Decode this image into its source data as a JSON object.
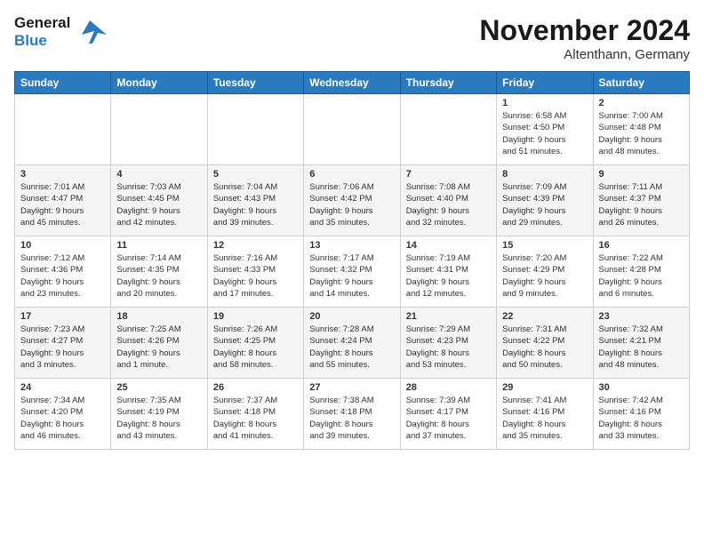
{
  "logo": {
    "line1": "General",
    "line2": "Blue"
  },
  "title": "November 2024",
  "location": "Altenthann, Germany",
  "weekdays": [
    "Sunday",
    "Monday",
    "Tuesday",
    "Wednesday",
    "Thursday",
    "Friday",
    "Saturday"
  ],
  "weeks": [
    [
      {
        "day": "",
        "info": ""
      },
      {
        "day": "",
        "info": ""
      },
      {
        "day": "",
        "info": ""
      },
      {
        "day": "",
        "info": ""
      },
      {
        "day": "",
        "info": ""
      },
      {
        "day": "1",
        "info": "Sunrise: 6:58 AM\nSunset: 4:50 PM\nDaylight: 9 hours\nand 51 minutes."
      },
      {
        "day": "2",
        "info": "Sunrise: 7:00 AM\nSunset: 4:48 PM\nDaylight: 9 hours\nand 48 minutes."
      }
    ],
    [
      {
        "day": "3",
        "info": "Sunrise: 7:01 AM\nSunset: 4:47 PM\nDaylight: 9 hours\nand 45 minutes."
      },
      {
        "day": "4",
        "info": "Sunrise: 7:03 AM\nSunset: 4:45 PM\nDaylight: 9 hours\nand 42 minutes."
      },
      {
        "day": "5",
        "info": "Sunrise: 7:04 AM\nSunset: 4:43 PM\nDaylight: 9 hours\nand 39 minutes."
      },
      {
        "day": "6",
        "info": "Sunrise: 7:06 AM\nSunset: 4:42 PM\nDaylight: 9 hours\nand 35 minutes."
      },
      {
        "day": "7",
        "info": "Sunrise: 7:08 AM\nSunset: 4:40 PM\nDaylight: 9 hours\nand 32 minutes."
      },
      {
        "day": "8",
        "info": "Sunrise: 7:09 AM\nSunset: 4:39 PM\nDaylight: 9 hours\nand 29 minutes."
      },
      {
        "day": "9",
        "info": "Sunrise: 7:11 AM\nSunset: 4:37 PM\nDaylight: 9 hours\nand 26 minutes."
      }
    ],
    [
      {
        "day": "10",
        "info": "Sunrise: 7:12 AM\nSunset: 4:36 PM\nDaylight: 9 hours\nand 23 minutes."
      },
      {
        "day": "11",
        "info": "Sunrise: 7:14 AM\nSunset: 4:35 PM\nDaylight: 9 hours\nand 20 minutes."
      },
      {
        "day": "12",
        "info": "Sunrise: 7:16 AM\nSunset: 4:33 PM\nDaylight: 9 hours\nand 17 minutes."
      },
      {
        "day": "13",
        "info": "Sunrise: 7:17 AM\nSunset: 4:32 PM\nDaylight: 9 hours\nand 14 minutes."
      },
      {
        "day": "14",
        "info": "Sunrise: 7:19 AM\nSunset: 4:31 PM\nDaylight: 9 hours\nand 12 minutes."
      },
      {
        "day": "15",
        "info": "Sunrise: 7:20 AM\nSunset: 4:29 PM\nDaylight: 9 hours\nand 9 minutes."
      },
      {
        "day": "16",
        "info": "Sunrise: 7:22 AM\nSunset: 4:28 PM\nDaylight: 9 hours\nand 6 minutes."
      }
    ],
    [
      {
        "day": "17",
        "info": "Sunrise: 7:23 AM\nSunset: 4:27 PM\nDaylight: 9 hours\nand 3 minutes."
      },
      {
        "day": "18",
        "info": "Sunrise: 7:25 AM\nSunset: 4:26 PM\nDaylight: 9 hours\nand 1 minute."
      },
      {
        "day": "19",
        "info": "Sunrise: 7:26 AM\nSunset: 4:25 PM\nDaylight: 8 hours\nand 58 minutes."
      },
      {
        "day": "20",
        "info": "Sunrise: 7:28 AM\nSunset: 4:24 PM\nDaylight: 8 hours\nand 55 minutes."
      },
      {
        "day": "21",
        "info": "Sunrise: 7:29 AM\nSunset: 4:23 PM\nDaylight: 8 hours\nand 53 minutes."
      },
      {
        "day": "22",
        "info": "Sunrise: 7:31 AM\nSunset: 4:22 PM\nDaylight: 8 hours\nand 50 minutes."
      },
      {
        "day": "23",
        "info": "Sunrise: 7:32 AM\nSunset: 4:21 PM\nDaylight: 8 hours\nand 48 minutes."
      }
    ],
    [
      {
        "day": "24",
        "info": "Sunrise: 7:34 AM\nSunset: 4:20 PM\nDaylight: 8 hours\nand 46 minutes."
      },
      {
        "day": "25",
        "info": "Sunrise: 7:35 AM\nSunset: 4:19 PM\nDaylight: 8 hours\nand 43 minutes."
      },
      {
        "day": "26",
        "info": "Sunrise: 7:37 AM\nSunset: 4:18 PM\nDaylight: 8 hours\nand 41 minutes."
      },
      {
        "day": "27",
        "info": "Sunrise: 7:38 AM\nSunset: 4:18 PM\nDaylight: 8 hours\nand 39 minutes."
      },
      {
        "day": "28",
        "info": "Sunrise: 7:39 AM\nSunset: 4:17 PM\nDaylight: 8 hours\nand 37 minutes."
      },
      {
        "day": "29",
        "info": "Sunrise: 7:41 AM\nSunset: 4:16 PM\nDaylight: 8 hours\nand 35 minutes."
      },
      {
        "day": "30",
        "info": "Sunrise: 7:42 AM\nSunset: 4:16 PM\nDaylight: 8 hours\nand 33 minutes."
      }
    ]
  ]
}
